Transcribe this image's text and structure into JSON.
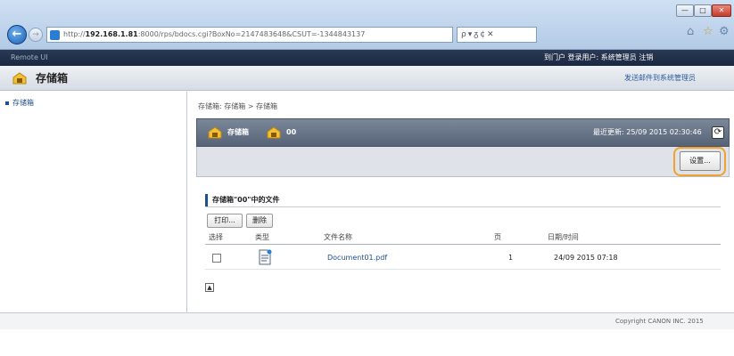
{
  "browser": {
    "window_controls": {
      "minimize": "—",
      "maximize": "□",
      "close": "✕"
    },
    "address_url_bold": "192.168.1.81",
    "address_url_prefix": "http://",
    "address_url_suffix": ":8000/rps/bdocs.cgi?BoxNo=2147483648&CSUT=-1344843137",
    "address_tools": "ρ▾ᵹ¢✕",
    "icons": [
      "back-arrow-icon",
      "forward-arrow-icon",
      "home-icon",
      "star-icon",
      "gear-icon"
    ]
  },
  "header": {
    "left_text": "Remote UI",
    "right_text": "到门户 登录用户: 系统管理员 注销",
    "title": "存储箱",
    "admin_link": "发送邮件到系统管理员"
  },
  "sidebar": {
    "items": [
      {
        "label": "存储箱"
      }
    ]
  },
  "main": {
    "breadcrumb": "存储箱: 存储箱 > 存储箱",
    "panel": {
      "label1": "存储箱",
      "label2": "00",
      "last_updated": "最近更新: 25/09 2015 02:30:46",
      "settings_button": "设置..."
    },
    "section_title": "存储箱\"00\"中的文件",
    "buttons": {
      "print": "打印...",
      "delete": "删除"
    },
    "table": {
      "headers": {
        "select": "选择",
        "type": "类型",
        "name": "文件名称",
        "pages": "页",
        "date": "日期/时间"
      },
      "rows": [
        {
          "name": "Document01.pdf",
          "pages": "1",
          "date": "24/09 2015 07:18"
        }
      ]
    },
    "page_top_glyph": "▲"
  },
  "footer": {
    "copyright": "Copyright CANON INC. 2015"
  },
  "colors": {
    "accent": "#1f4e8c",
    "highlight": "#f0a22a",
    "header_dark": "#1a2740"
  }
}
